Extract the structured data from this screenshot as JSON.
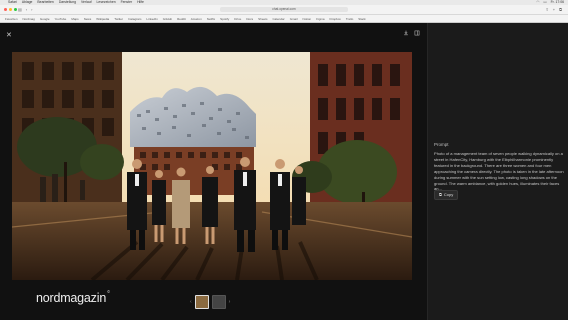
{
  "menubar": {
    "items": [
      "Safari",
      "Ablage",
      "Bearbeiten",
      "Darstellung",
      "Verlauf",
      "Lesezeichen",
      "Fenster",
      "Hilfe"
    ],
    "clock": "Fr. 17:06"
  },
  "browser": {
    "url": "chat.openai.com",
    "bookmarks": [
      "Favoriten",
      "Nordmag",
      "Google",
      "YouTube",
      "Maps",
      "News",
      "Wikipedia",
      "Twitter",
      "Instagram",
      "LinkedIn",
      "GitHub",
      "Reddit",
      "Amazon",
      "Netflix",
      "Spotify",
      "Drive",
      "Docs",
      "Sheets",
      "Calendar",
      "Gmail",
      "Notion",
      "Figma",
      "Dropbox",
      "Trello",
      "Slack"
    ]
  },
  "prompt": {
    "label": "Prompt",
    "text": "Photo of a management team of seven people walking dynamically on a street in HafenCity, Hamburg with the Elbphilharmonie prominently featured in the background. There are three women and four men approaching the camera directly. The photo is taken in the late afternoon during summer with the sun setting low, casting long shadows on the ground. The warm ambiance, with golden hues, illuminates their faces an...",
    "copy_label": "Copy"
  },
  "watermark": {
    "text": "nordmagazin",
    "mark": "©"
  },
  "colors": {
    "background": "#141414",
    "sidebar": "#1b1b1b",
    "accent": "#e0e0e0"
  }
}
